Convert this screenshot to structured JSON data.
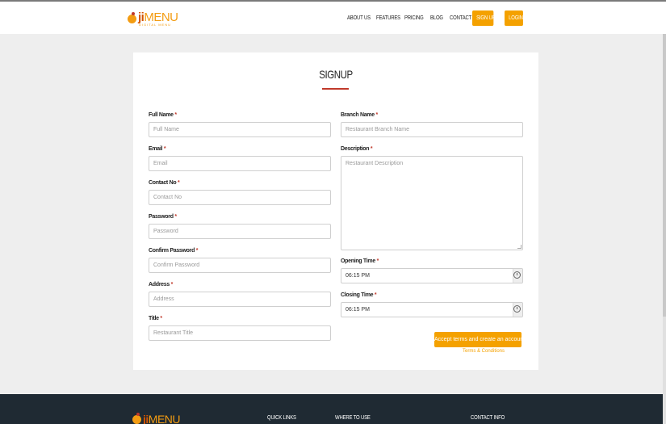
{
  "brand": {
    "name_part1": "ji",
    "name_part2": "MENU",
    "tagline": "DIGITAL MENU"
  },
  "nav": {
    "about": "ABOUT US",
    "features": "FEATURES",
    "pricing": "PRICING",
    "blog": "BLOG",
    "contact": "CONTACT",
    "signup": "SIGN UP",
    "login": "LOGIN"
  },
  "colors": {
    "accent": "#f4a100",
    "required": "#c0392b",
    "footer": "#1f2a33"
  },
  "form": {
    "title": "SIGNUP",
    "required_mark": "*",
    "full_name": {
      "label": "Full Name",
      "placeholder": "Full Name"
    },
    "email": {
      "label": "Email",
      "placeholder": "Email"
    },
    "contact": {
      "label": "Contact No",
      "placeholder": "Contact No"
    },
    "password": {
      "label": "Password",
      "placeholder": "Password"
    },
    "confirm": {
      "label": "Confirm Password",
      "placeholder": "Confirm Password"
    },
    "address": {
      "label": "Address",
      "placeholder": "Address"
    },
    "title_field": {
      "label": "Title",
      "placeholder": "Restaurant Title"
    },
    "branch": {
      "label": "Branch Name",
      "placeholder": "Restaurant Branch Name"
    },
    "description": {
      "label": "Description",
      "placeholder": "Restaurant Description"
    },
    "opening": {
      "label": "Opening Time",
      "value": "06:15 PM"
    },
    "closing": {
      "label": "Closing Time",
      "value": "06:15 PM"
    },
    "submit": "Accept terms and create an account",
    "terms": "Terms & Conditions"
  },
  "footer": {
    "quick_links": "QUICK LINKS",
    "where_to_use": "WHERE TO USE",
    "contact_info": "CONTACT INFO"
  }
}
